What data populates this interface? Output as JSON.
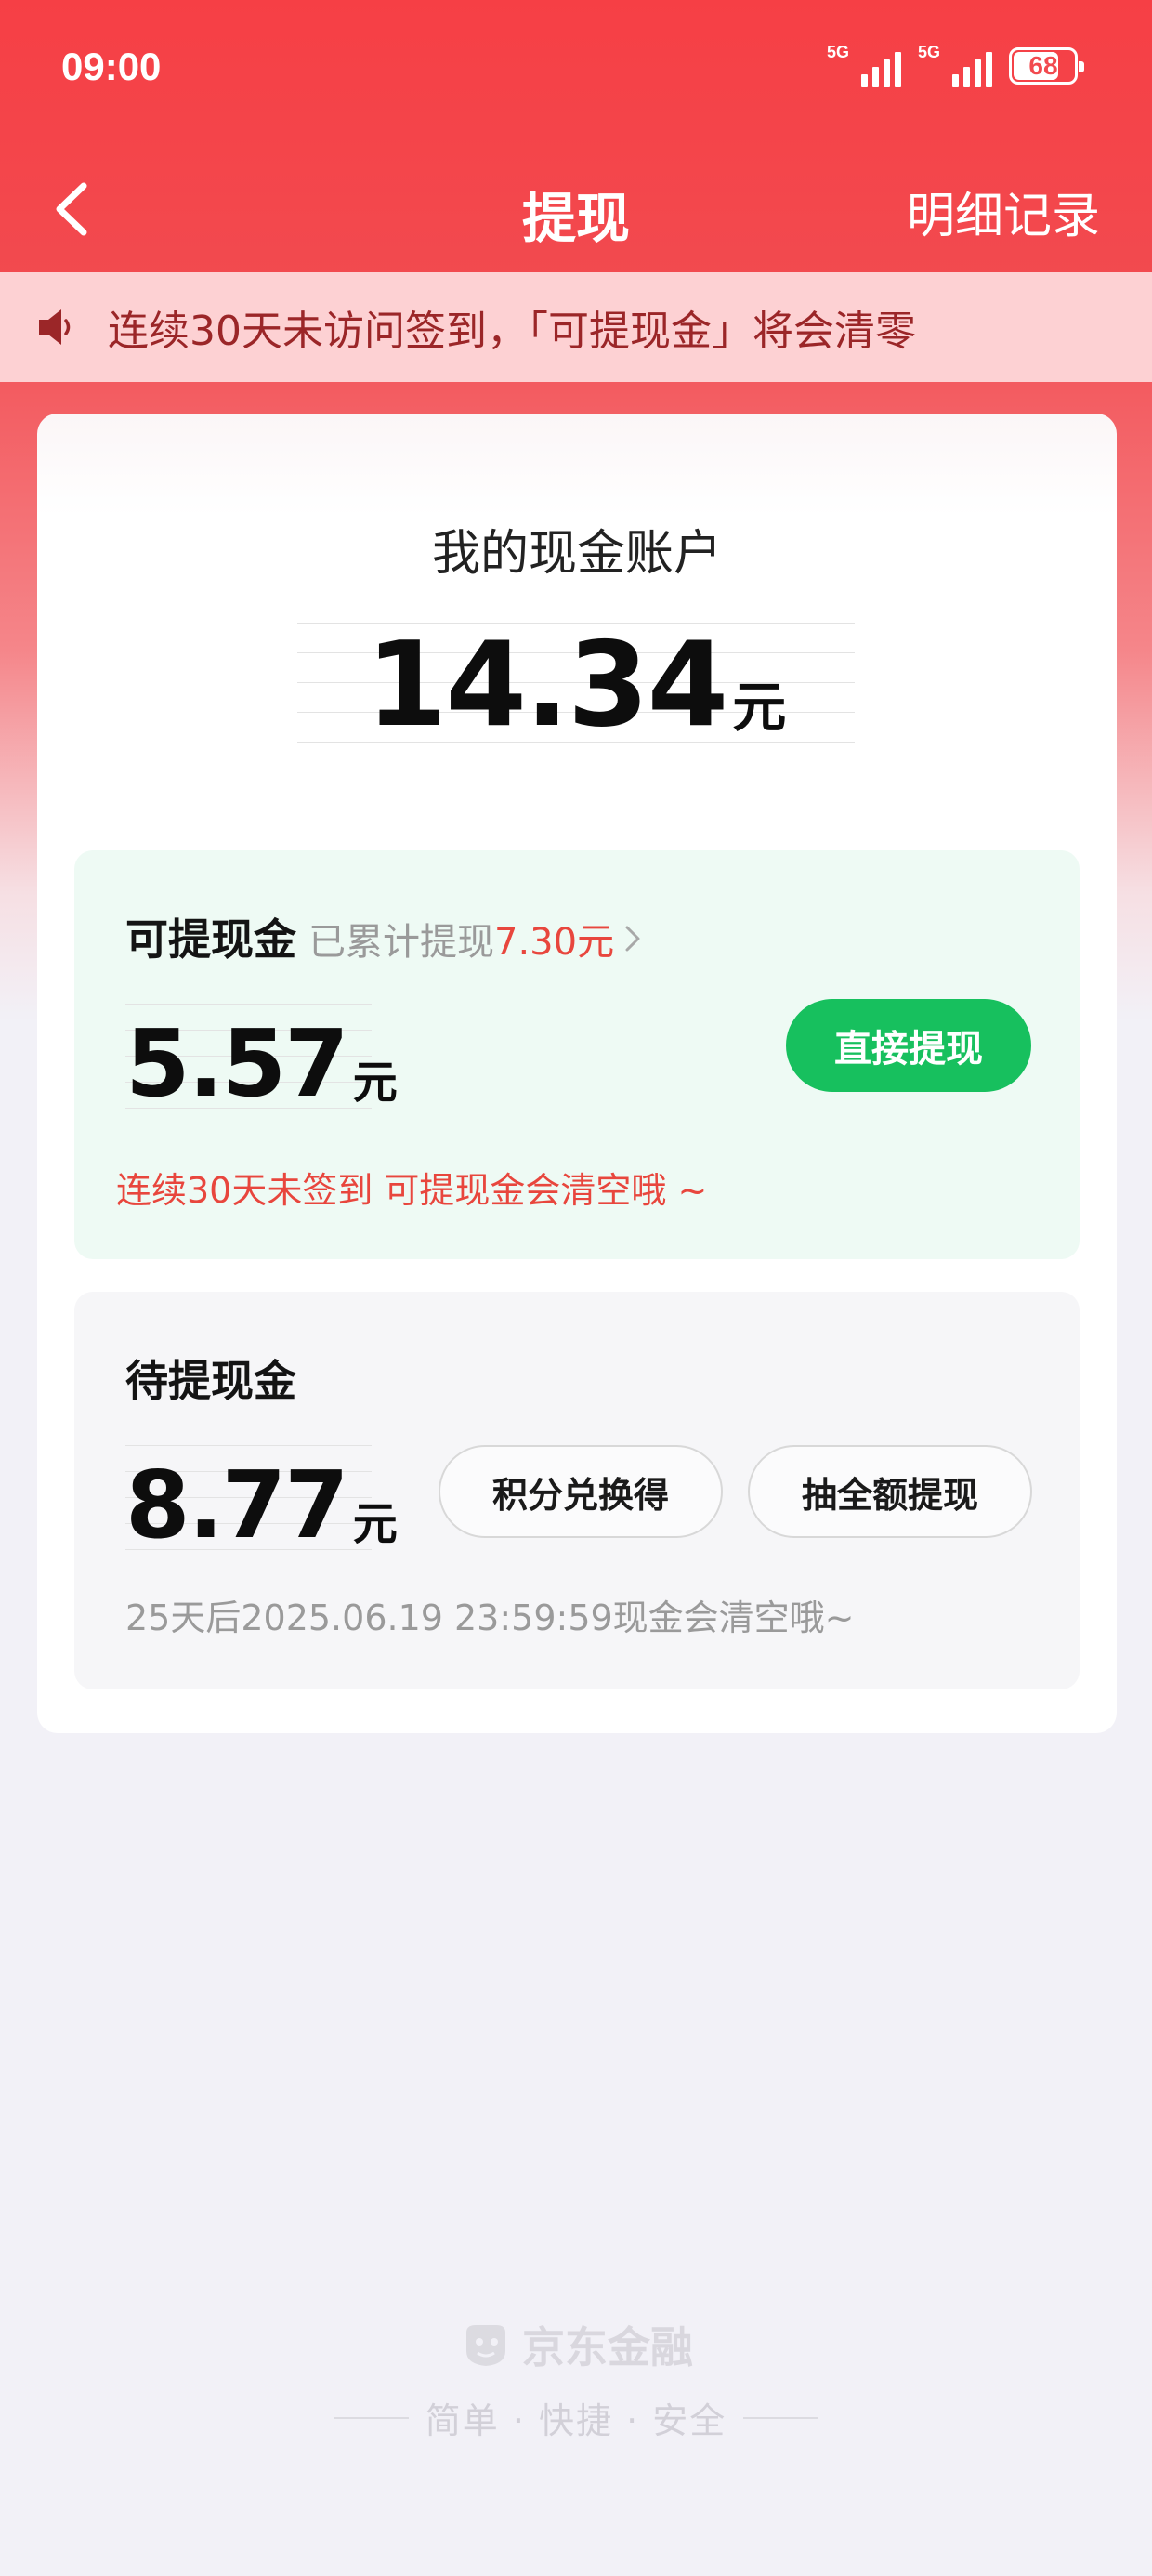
{
  "status_bar": {
    "time": "09:00",
    "signal1_label": "5G",
    "signal2_label": "5G",
    "battery": "68"
  },
  "nav": {
    "title": "提现",
    "right_label": "明细记录"
  },
  "notice": {
    "text": "连续30天未访问签到，「可提现金」将会清零"
  },
  "account": {
    "title": "我的现金账户",
    "amount": "14.34",
    "unit": "元"
  },
  "withdrawable": {
    "title": "可提现金",
    "cumulative_prefix": "已累计提现",
    "cumulative_amount": "7.30元",
    "amount": "5.57",
    "unit": "元",
    "button": "直接提现",
    "warning": "连续30天未签到 可提现金会清空哦 ~"
  },
  "pending": {
    "title": "待提现金",
    "amount": "8.77",
    "unit": "元",
    "exchange_button": "积分兑换得",
    "draw_button": "抽全额提现",
    "expire_text": "25天后2025.06.19 23:59:59现金会清空哦~"
  },
  "footer": {
    "brand": "京东金融",
    "slogan": "简单 · 快捷 · 安全"
  },
  "colors": {
    "primary_red": "#f63f45",
    "accent_red": "#e8463d",
    "green": "#17c05e"
  },
  "icons": {
    "back": "chevron-left-icon",
    "speaker": "speaker-icon",
    "chevron": "chevron-right-icon"
  }
}
